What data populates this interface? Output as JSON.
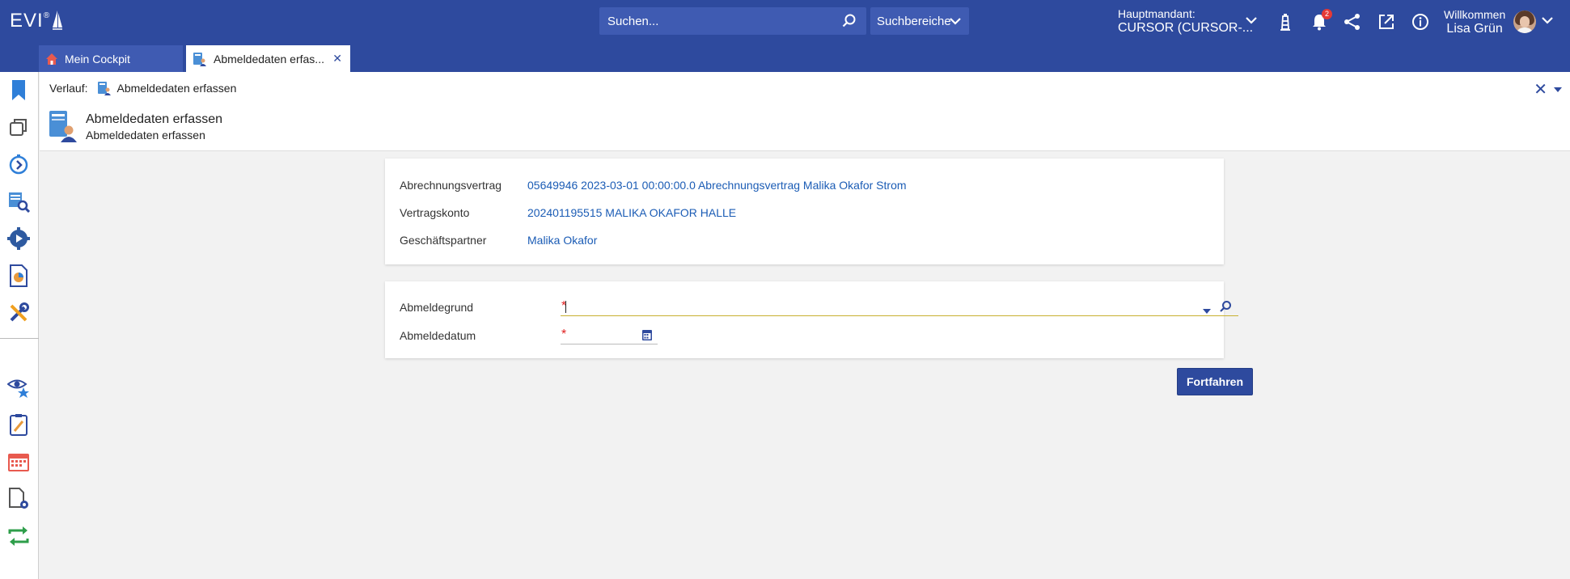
{
  "app": {
    "logo": "EVI",
    "logo_reg": "®"
  },
  "search": {
    "placeholder": "Suchen..."
  },
  "search_scope": {
    "label": "Suchbereiche"
  },
  "mandant": {
    "label": "Hauptmandant:",
    "value": "CURSOR (CURSOR-..."
  },
  "notifications": {
    "count": "2"
  },
  "user": {
    "greeting": "Willkommen",
    "name": "Lisa Grün"
  },
  "tabs": [
    {
      "label": "Mein Cockpit"
    },
    {
      "label": "Abmeldedaten erfas..."
    }
  ],
  "breadcrumb": {
    "prefix": "Verlauf:",
    "item": "Abmeldedaten erfassen"
  },
  "page": {
    "title": "Abmeldedaten erfassen",
    "subtitle": "Abmeldedaten erfassen"
  },
  "info": {
    "rows": [
      {
        "label": "Abrechnungsvertrag",
        "value": "05649946 2023-03-01 00:00:00.0 Abrechnungsvertrag Malika Okafor Strom"
      },
      {
        "label": "Vertragskonto",
        "value": "202401195515 MALIKA OKAFOR HALLE"
      },
      {
        "label": "Geschäftspartner",
        "value": "Malika Okafor"
      }
    ]
  },
  "form": {
    "reason_label": "Abmeldegrund",
    "reason_value": "",
    "date_label": "Abmeldedatum",
    "date_value": "",
    "required_marker": "*"
  },
  "actions": {
    "continue": "Fortfahren"
  },
  "colors": {
    "primary": "#2e4a9e",
    "link": "#1b5cb5",
    "required": "#e02020"
  }
}
